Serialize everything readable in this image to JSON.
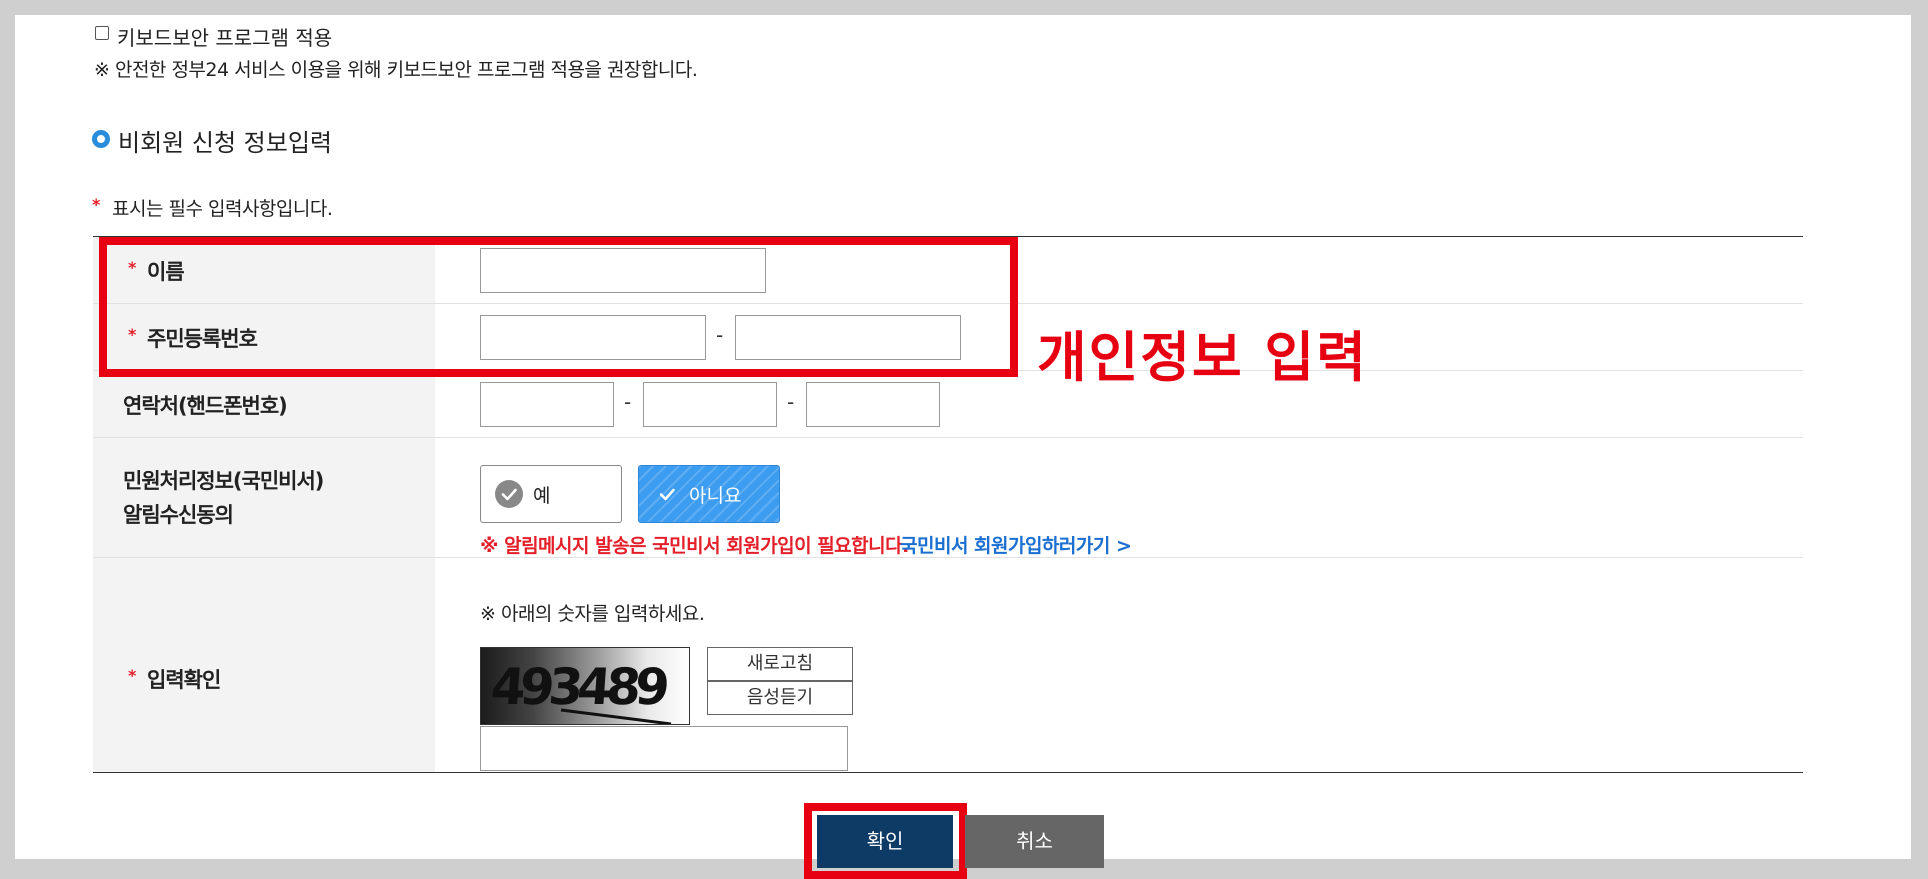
{
  "keyboard_security": {
    "checkbox_label": "키보드보안 프로그램 적용",
    "notice": "※ 안전한 정부24 서비스 이용을 위해 키보드보안 프로그램 적용을 권장합니다."
  },
  "section": {
    "title": "비회원 신청 정보입력",
    "required_note": "표시는 필수 입력사항입니다.",
    "required_mark": "*"
  },
  "form": {
    "name_label": "이름",
    "resident_number_label": "주민등록번호",
    "phone_label": "연락처(핸드폰번호)",
    "separator": "-",
    "consent_label_line1": "민원처리정보(국민비서)",
    "consent_label_line2": "알림수신동의",
    "consent_yes": "예",
    "consent_no": "아니요",
    "consent_notice_red": "※  알림메시지 발송은 국민비서 회원가입이 필요합니다.",
    "consent_notice_link": "국민비서 회원가입하러가기 >",
    "captcha_label": "입력확인",
    "captcha_instruction": "※ 아래의 숫자를 입력하세요.",
    "captcha_image_text": "493489",
    "refresh_button": "새로고침",
    "audio_button": "음성듣기"
  },
  "annotation": {
    "text": "개인정보 입력"
  },
  "actions": {
    "confirm": "확인",
    "cancel": "취소"
  },
  "colors": {
    "required_red": "#e41f29",
    "annotation_red": "#e60012",
    "link_blue": "#1a6fd1",
    "selected_blue": "#3c9cf0",
    "confirm_navy": "#0e3b66",
    "cancel_gray": "#666666",
    "radio_blue": "#2a8ddb"
  }
}
